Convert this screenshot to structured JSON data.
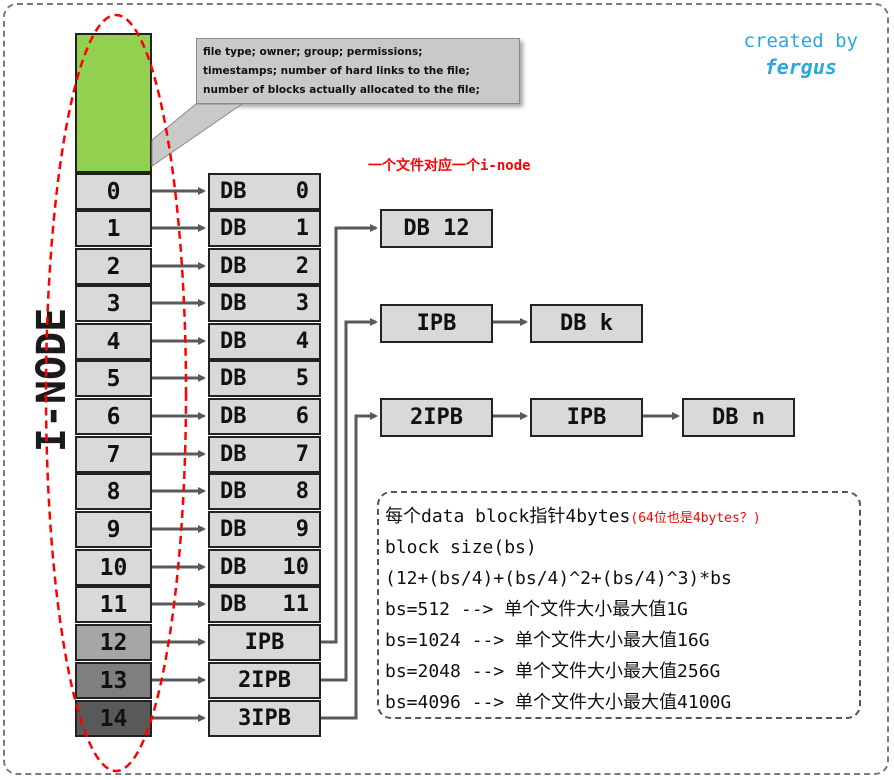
{
  "credit": {
    "line1": "created by",
    "line2": "fergus"
  },
  "side_label": "I-NODE",
  "callout": [
    "file type; owner; group; permissions;",
    "timestamps; number of hard links to the file;",
    "number of  blocks actually allocated to the file;"
  ],
  "note": "一个文件对应一个i-node",
  "inode_slots": [
    "0",
    "1",
    "2",
    "3",
    "4",
    "5",
    "6",
    "7",
    "8",
    "9",
    "10",
    "11",
    "12",
    "13",
    "14"
  ],
  "direct_blocks": {
    "label": "DB",
    "numbers": [
      "0",
      "1",
      "2",
      "3",
      "4",
      "5",
      "6",
      "7",
      "8",
      "9",
      "10",
      "11"
    ]
  },
  "indirect_blocks": [
    "IPB",
    "2IPB",
    "3IPB"
  ],
  "chains": {
    "single": [
      "DB 12"
    ],
    "double": [
      "IPB",
      "DB k"
    ],
    "triple": [
      "2IPB",
      "IPB",
      "DB n"
    ]
  },
  "formula": {
    "line1_main": "每个data block指针4bytes",
    "line1_note": "(64位也是4bytes？)",
    "line2": "block size(bs)",
    "line3": "(12+(bs/4)+(bs/4)^2+(bs/4)^3)*bs",
    "rows": [
      "bs=512   --> 单个文件大小最大值1G",
      "bs=1024  --> 单个文件大小最大值16G",
      "bs=2048  --> 单个文件大小最大值256G",
      "bs=4096  --> 单个文件大小最大值4100G"
    ]
  },
  "colors": {
    "header_block": "#92d050",
    "cell": "#d9d9d9",
    "cell_12": "#a6a6a6",
    "cell_13": "#7f7f7f",
    "cell_14": "#595959",
    "ellipse": "#ff0000",
    "credit": "#2aa7e0",
    "arrow": "#595959"
  }
}
